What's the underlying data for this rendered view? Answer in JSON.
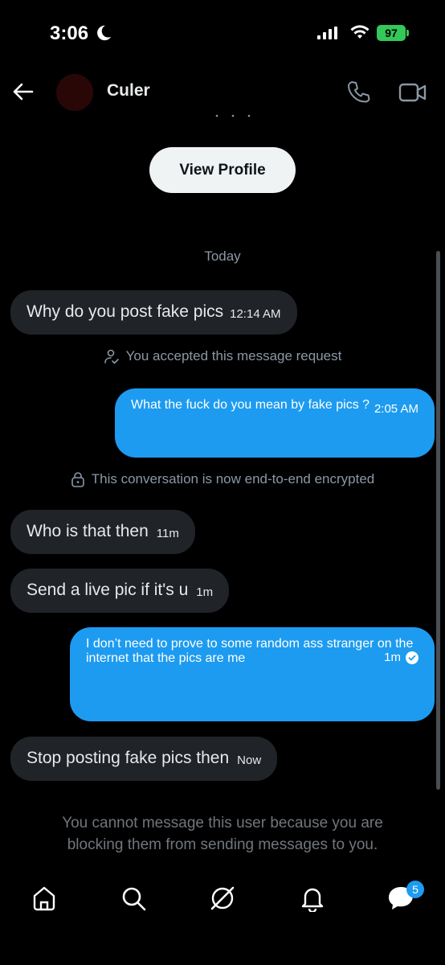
{
  "status_bar": {
    "time": "3:06",
    "battery": "97"
  },
  "header": {
    "contact_name": "Culer"
  },
  "view_profile_label": "View Profile",
  "day_separator": "Today",
  "messages": [
    {
      "text": "Why do you post fake pics",
      "time": "12:14 AM"
    },
    {
      "system": "You accepted this message request"
    },
    {
      "text": "What the fuck do you mean by fake pics ?",
      "time": "2:05 AM"
    },
    {
      "system": "This conversation is now end-to-end encrypted"
    },
    {
      "text": "Who is that then",
      "time": "11m"
    },
    {
      "text": "Send a live pic if it's u",
      "time": "1m"
    },
    {
      "text": "I don’t need to prove to some random ass stranger on the internet that the pics are me",
      "time": "1m"
    },
    {
      "text": "Stop posting fake pics then",
      "time": "Now"
    }
  ],
  "blocked_notice": "You cannot message this user because you are blocking them from sending messages to you.",
  "nav": {
    "messages_badge": "5"
  },
  "colors": {
    "accent": "#1d9bf0",
    "incoming_bubble": "#202327",
    "background": "#000000"
  }
}
